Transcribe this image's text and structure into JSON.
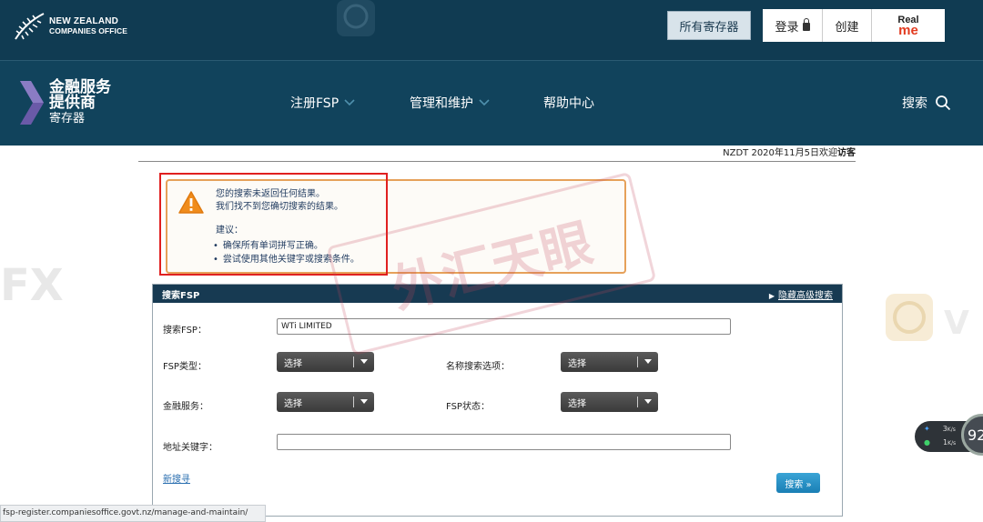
{
  "topbar": {
    "brand_line1": "NEW ZEALAND",
    "brand_line2": "COMPANIES OFFICE",
    "all_registers": "所有寄存器",
    "login": "登录",
    "create": "创建",
    "realme_real": "Real",
    "realme_me": "me"
  },
  "nav": {
    "logo_line1": "金融服务",
    "logo_line2": "提供商",
    "logo_line3": "寄存器",
    "items": [
      {
        "label": "注册FSP"
      },
      {
        "label": "管理和维护"
      },
      {
        "label": "帮助中心"
      }
    ],
    "search": "搜索"
  },
  "dateline": {
    "text": "NZDT 2020年11月5日欢迎",
    "user": "访客"
  },
  "warning": {
    "line1": "您的搜索未返回任何结果。",
    "line2": "我们找不到您确切搜索的结果。",
    "suggest_title": "建议：",
    "suggestions": [
      "确保所有单词拼写正确。",
      "尝试使用其他关键字或搜索条件。"
    ]
  },
  "search_panel": {
    "title": "搜索FSP",
    "advanced_link": "隐藏高级搜索",
    "fsp_label": "搜索FSP：",
    "fsp_value": "WTi LIMITED",
    "fsp_type_label": "FSP类型：",
    "name_option_label": "名称搜索选项：",
    "financial_service_label": "金融服务：",
    "fsp_status_label": "FSP状态：",
    "address_label": "地址关键字：",
    "address_value": "",
    "select_placeholder": "选择",
    "new_search": "新搜寻",
    "search_button": "搜索 »"
  },
  "statusbar": {
    "url": "fsp-register.companiesoffice.govt.nz/manage-and-maintain/"
  },
  "net_widget": {
    "up_value": "3",
    "up_unit": "K/s",
    "down_value": "1",
    "down_unit": "K/s",
    "percent": "92"
  },
  "watermark": {
    "text": "外汇天眼",
    "left_fragment": "FX",
    "right_fragment": "V"
  },
  "colors": {
    "topbar_bg": "#103b52",
    "nav_bg": "#11435c",
    "logo_chevron": "#6a5aa8",
    "warning_border": "#e6a15a",
    "red_frame": "#e02020",
    "search_button": "#1a7fb5"
  }
}
